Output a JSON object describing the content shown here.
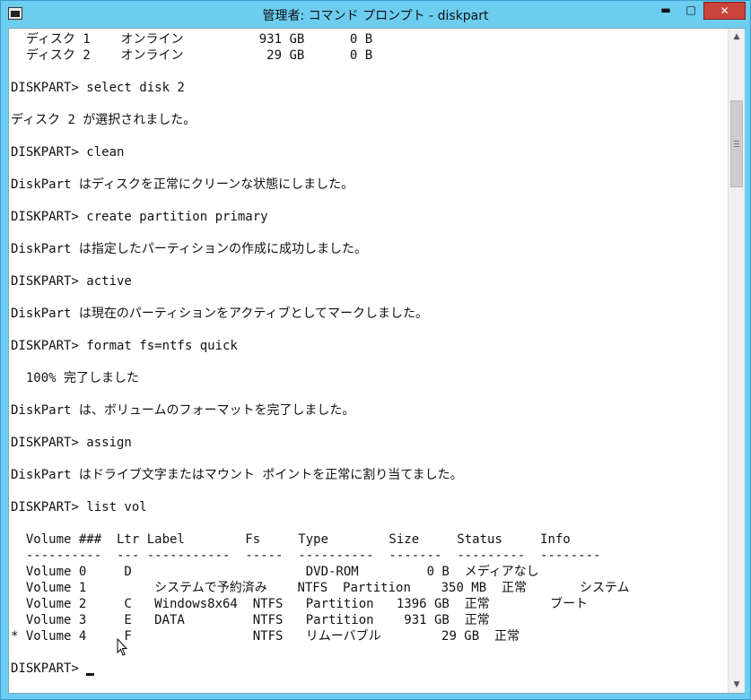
{
  "window": {
    "title": "管理者: コマンド プロンプト - diskpart",
    "controls": {
      "minimize": "▬",
      "maximize": "□",
      "close": "✕"
    }
  },
  "console": {
    "lines": [
      "  ディスク 1    オンライン          931 GB      0 B",
      "  ディスク 2    オンライン           29 GB      0 B",
      "",
      "DISKPART> select disk 2",
      "",
      "ディスク 2 が選択されました。",
      "",
      "DISKPART> clean",
      "",
      "DiskPart はディスクを正常にクリーンな状態にしました。",
      "",
      "DISKPART> create partition primary",
      "",
      "DiskPart は指定したパーティションの作成に成功しました。",
      "",
      "DISKPART> active",
      "",
      "DiskPart は現在のパーティションをアクティブとしてマークしました。",
      "",
      "DISKPART> format fs=ntfs quick",
      "",
      "  100% 完了しました",
      "",
      "DiskPart は、ボリュームのフォーマットを完了しました。",
      "",
      "DISKPART> assign",
      "",
      "DiskPart はドライブ文字またはマウント ポイントを正常に割り当てました。",
      "",
      "DISKPART> list vol",
      "",
      "  Volume ###  Ltr Label        Fs     Type        Size     Status     Info",
      "  ----------  --- -----------  -----  ----------  -------  ---------  --------",
      "  Volume 0     D                       DVD-ROM         0 B  メディアなし",
      "  Volume 1         システムで予約済み    NTFS  Partition    350 MB  正常       システム",
      "  Volume 2     C   Windows8x64  NTFS   Partition   1396 GB  正常        ブート",
      "  Volume 3     E   DATA         NTFS   Partition    931 GB  正常",
      "* Volume 4     F                NTFS   リムーバブル        29 GB  正常",
      "",
      "DISKPART> "
    ]
  },
  "scrollbar": {
    "up_icon": "▲",
    "down_icon": "▼"
  }
}
